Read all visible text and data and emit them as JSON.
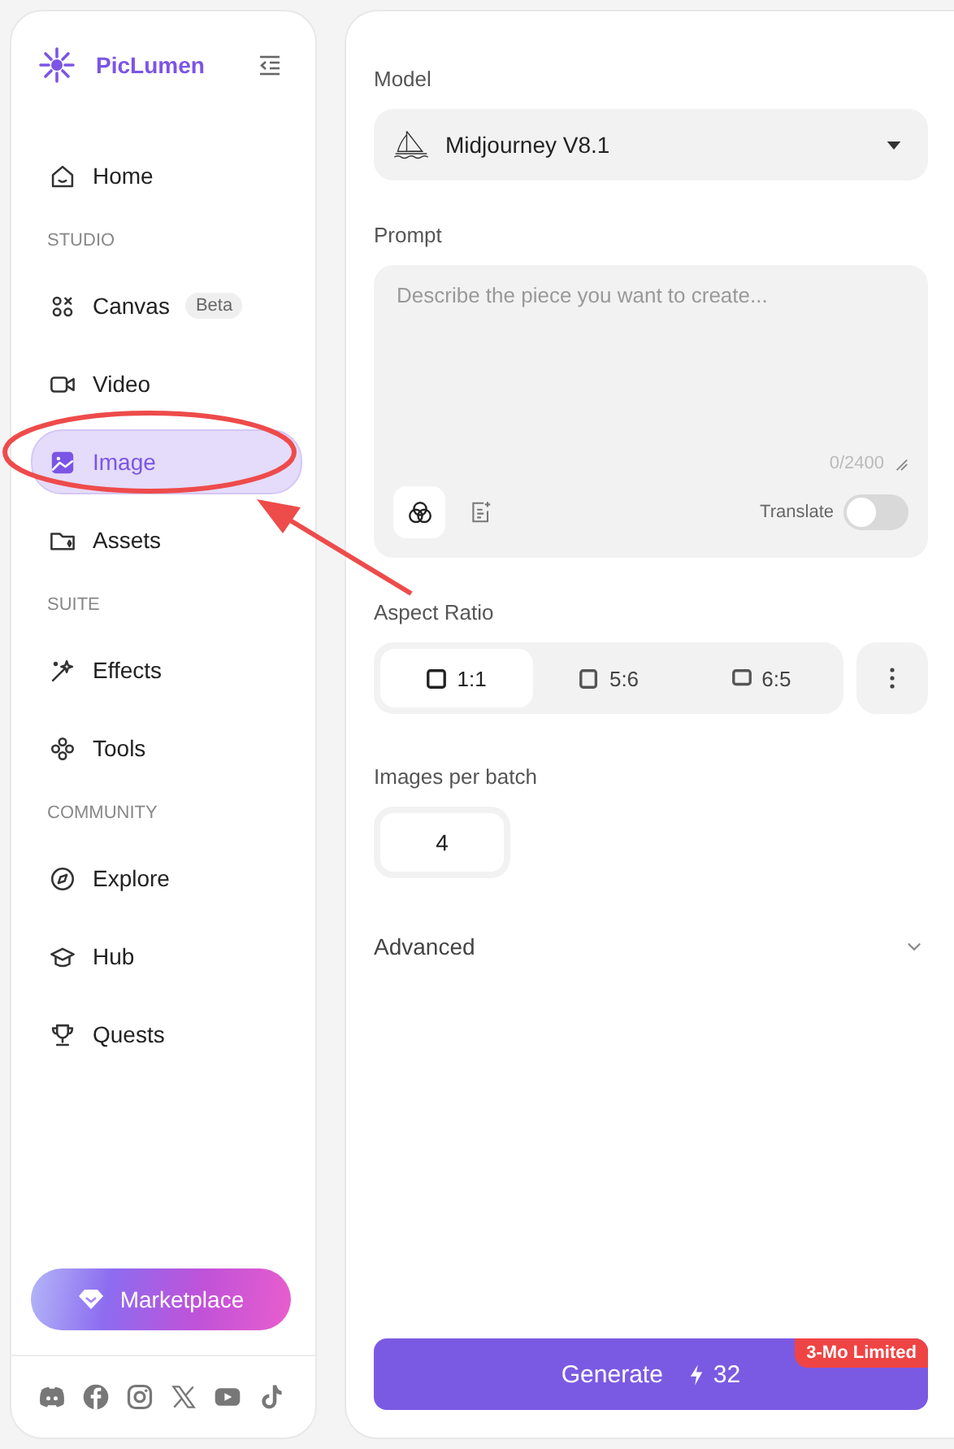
{
  "sidebar": {
    "brand": "PicLumen",
    "sections": [
      {
        "items": [
          {
            "label": "Home",
            "selected": false
          }
        ]
      },
      {
        "heading": "STUDIO",
        "items": [
          {
            "label": "Canvas",
            "badge": "Beta",
            "selected": false
          },
          {
            "label": "Video",
            "selected": false
          },
          {
            "label": "Image",
            "selected": true
          },
          {
            "label": "Assets",
            "selected": false
          }
        ]
      },
      {
        "heading": "SUITE",
        "items": [
          {
            "label": "Effects",
            "selected": false
          },
          {
            "label": "Tools",
            "selected": false
          }
        ]
      },
      {
        "heading": "COMMUNITY",
        "items": [
          {
            "label": "Explore",
            "selected": false
          },
          {
            "label": "Hub",
            "selected": false
          },
          {
            "label": "Quests",
            "selected": false
          }
        ]
      }
    ],
    "marketplace_button": "Marketplace"
  },
  "form": {
    "model_label": "Model",
    "model_value": "Midjourney V8.1",
    "prompt_label": "Prompt",
    "prompt_placeholder": "Describe the piece you want to create...",
    "prompt_count": "0/2400",
    "translate_label": "Translate",
    "translate_on": false,
    "aspect_label": "Aspect Ratio",
    "aspect_options": [
      {
        "label": "1:1",
        "selected": true
      },
      {
        "label": "5:6",
        "selected": false
      },
      {
        "label": "6:5",
        "selected": false
      }
    ],
    "batch_label": "Images per batch",
    "batch_value": "4",
    "advanced_label": "Advanced",
    "generate": {
      "label": "Generate",
      "cost": "32",
      "badge": "3-Mo Limited"
    }
  }
}
